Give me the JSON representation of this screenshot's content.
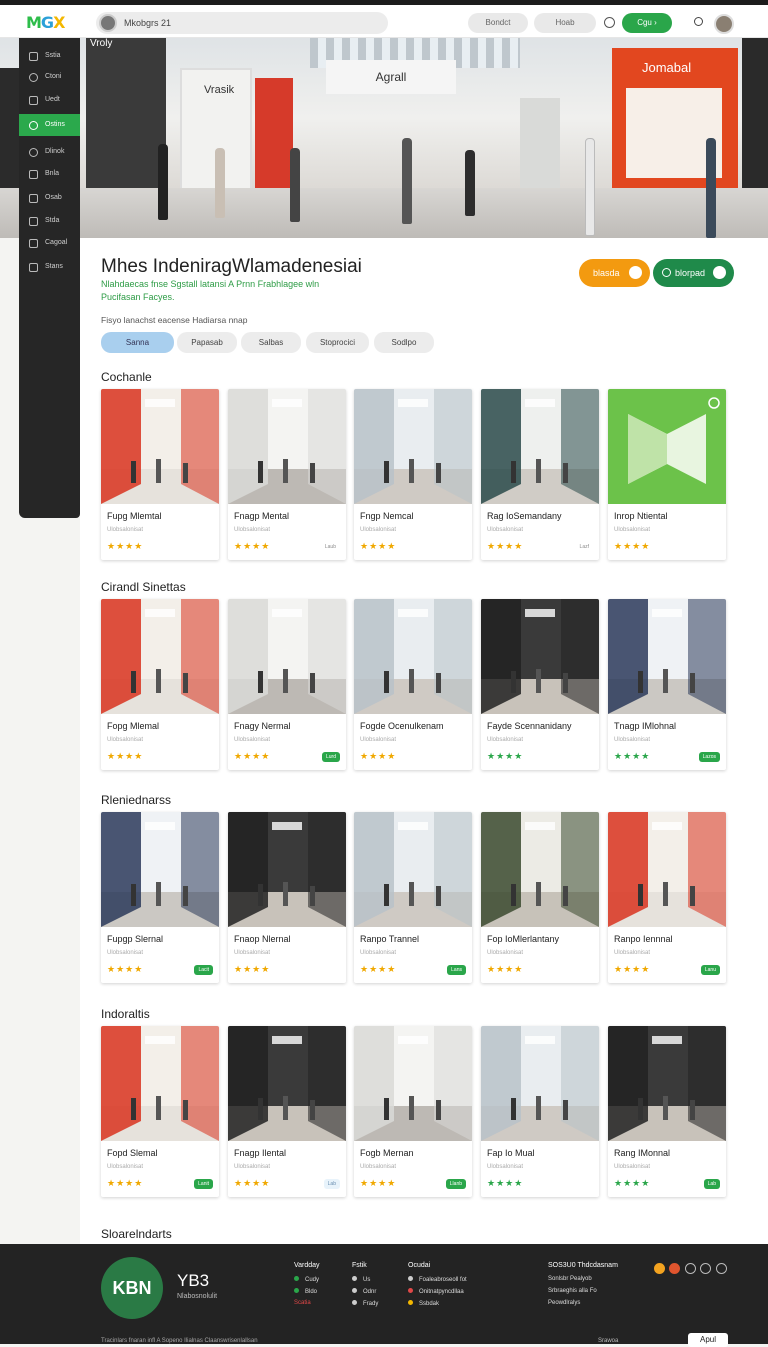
{
  "topbar": {
    "logo": "MGX",
    "search_text": "Mkobgrs 21",
    "btn1": "Bondct",
    "btn2": "Hoab",
    "btn_green": "Cgu",
    "btn_green_icon": "arrow-right-icon"
  },
  "hero": {
    "sign_left": "Vroly",
    "sign_mid": "Agrall",
    "sign_store": "Vrasik",
    "sign_right": "Jomabal"
  },
  "sidebar": {
    "items": [
      {
        "label": "Sstia",
        "icon": "grid-icon"
      },
      {
        "label": "Ctoni",
        "icon": "clock-icon"
      },
      {
        "label": "Uedt",
        "icon": "pen-icon"
      },
      {
        "label": "Ostins",
        "icon": "settings-icon"
      },
      {
        "label": "Dlinok",
        "icon": "search-icon"
      },
      {
        "label": "Bnla",
        "icon": "list-icon"
      },
      {
        "label": "Osab",
        "icon": "people-icon"
      },
      {
        "label": "Stda",
        "icon": "tag-icon"
      },
      {
        "label": "Cagoal",
        "icon": "shop-icon"
      },
      {
        "label": "Stans",
        "icon": "doc-icon"
      }
    ]
  },
  "header": {
    "title": "Mhes IndeniragWlamadenesiai",
    "subtitle": "Nlahdaecas fnse Sgstall latansi A Prnn Frabhlagee wln Pucifasan Facyes.",
    "btn_orange": "blasda",
    "btn_green": "blorpad"
  },
  "filters": {
    "label": "Fisyo lanachst eacense Hadiarsa nnap",
    "chips": [
      "Sanna",
      "Papasab",
      "Salbas",
      "Stoprocici",
      "Sodlpo"
    ]
  },
  "sections": [
    {
      "title": "Cochanle",
      "cards": [
        {
          "name": "Fupg Mlemtal",
          "sub": "Ulobsalonisat",
          "stars": "★★★★",
          "badge": "",
          "theme": "store-red"
        },
        {
          "name": "Fnagp Mental",
          "sub": "Ulobsalonisat",
          "stars": "★★★★",
          "badge": "Laub",
          "theme": "store-white"
        },
        {
          "name": "Fngp Nemcal",
          "sub": "Ulobsalonisat",
          "stars": "★★★★",
          "badge": "",
          "theme": "mall"
        },
        {
          "name": "Rag IoSemandany",
          "sub": "Ulobsalonisat",
          "stars": "★★★★",
          "badge": "Lazf",
          "theme": "store-teal"
        },
        {
          "name": "Inrop Ntiental",
          "sub": "Ulobsalonisat",
          "stars": "★★★★",
          "badge": "",
          "theme": "icon-green"
        }
      ]
    },
    {
      "title": "Cirandl Sinettas",
      "cards": [
        {
          "name": "Fopg Mlemal",
          "sub": "Ulobsalonisat",
          "stars": "★★★★",
          "badge": "",
          "theme": "store-red"
        },
        {
          "name": "Fnagy Nermal",
          "sub": "Ulobsalonisat",
          "stars": "★★★★",
          "badge": "Lurd",
          "theme": "store-white"
        },
        {
          "name": "Fogde Ocenulkenam",
          "sub": "Ulobsalonisat",
          "stars": "★★★★",
          "badge": "",
          "theme": "mall"
        },
        {
          "name": "Fayde Scennanidany",
          "sub": "Ulobsalonisat",
          "stars": "★★★★",
          "badge": "",
          "theme": "store-dark",
          "green": true
        },
        {
          "name": "Tnagp IMlohnal",
          "sub": "Ulobsalonisat",
          "stars": "★★★★",
          "badge": "Lazos",
          "theme": "store-blue",
          "green": true
        }
      ]
    },
    {
      "title": "Rleniednarss",
      "cards": [
        {
          "name": "Fupgp Slernal",
          "sub": "Ulobsalonisat",
          "stars": "★★★★",
          "badge": "Lacit",
          "theme": "store-blue"
        },
        {
          "name": "Fnaop Nlernal",
          "sub": "Ulobsalonisat",
          "stars": "★★★★",
          "badge": "",
          "theme": "store-dark"
        },
        {
          "name": "Ranpo Trannel",
          "sub": "Ulobsalonisat",
          "stars": "★★★★",
          "badge": "Lans",
          "theme": "mall"
        },
        {
          "name": "Fop IoMlerlantany",
          "sub": "Ulobsalonisat",
          "stars": "★★★★",
          "badge": "",
          "theme": "store-olive"
        },
        {
          "name": "Ranpo Iennnal",
          "sub": "Ulobsalonisat",
          "stars": "★★★★",
          "badge": "Lanu",
          "theme": "store-red"
        }
      ]
    },
    {
      "title": "Indoraltis",
      "cards": [
        {
          "name": "Fopd Slemal",
          "sub": "Ulobsalonisat",
          "stars": "★★★★",
          "badge": "Lanit",
          "theme": "store-red"
        },
        {
          "name": "Fnagp Ilental",
          "sub": "Ulobsalonisat",
          "stars": "★★★★",
          "badge": "Lab",
          "theme": "store-dark"
        },
        {
          "name": "Fogb Mernan",
          "sub": "Ulobsalonisat",
          "stars": "★★★★",
          "badge": "Llanb",
          "theme": "store-white"
        },
        {
          "name": "Fap Io Mual",
          "sub": "Ulobsalonisat",
          "stars": "★★★★",
          "badge": "",
          "theme": "mall",
          "green": true
        },
        {
          "name": "Rang IMonnal",
          "sub": "Ulobsalonisat",
          "stars": "★★★★",
          "badge": "Lab",
          "theme": "store-dark",
          "green": true
        }
      ]
    }
  ],
  "bottom_section_title": "Sloarelndarts",
  "footer": {
    "logo_text": "KBN",
    "brand": "YB3",
    "brand_sub": "Nlabosnolulit",
    "col1": {
      "h": "Vardday",
      "items": [
        "Cudy",
        "Bldo",
        "Scatia"
      ]
    },
    "col2": {
      "h": "Fstik",
      "items": [
        "Us",
        "Odnr",
        "Frady"
      ]
    },
    "col3": {
      "h": "Ocudai",
      "items": [
        "Foaleabroseoll fot",
        "Onitnatpyncdllaa",
        "Ssbdak"
      ]
    },
    "col4": {
      "h": "SOS3U0 Thdcdasnam",
      "items": [
        "Sonlsbr Pealyob",
        "Srbraeghis alla Fo",
        "Peowdlralys"
      ]
    },
    "bottom_text": "Tracinlars fnaran infl A Sopeno Ilialnas Claanswrisenlallsan",
    "bottom_link": "Srawoa",
    "bottom_btn": "Apul"
  },
  "colors": {
    "accent_green": "#2aa64a",
    "accent_orange": "#f39a10",
    "sidebar_bg": "#262626",
    "footer_bg": "#232323"
  }
}
